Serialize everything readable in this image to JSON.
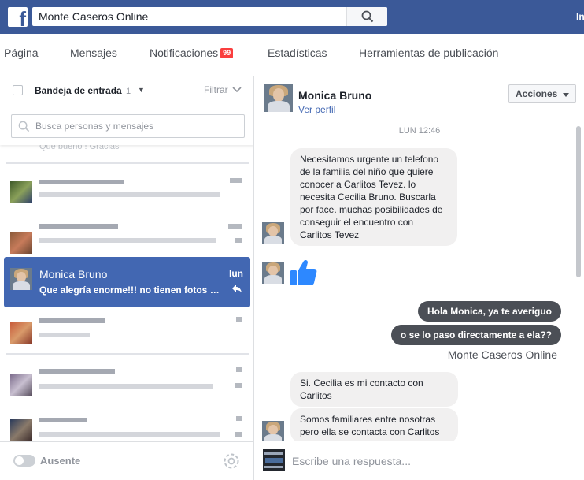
{
  "topbar": {
    "search_value": "Monte Caseros Online",
    "user_short": "In",
    "logo_letter": "f"
  },
  "page_nav": {
    "tabs": [
      "Página",
      "Mensajes",
      "Notificaciones",
      "Estadísticas",
      "Herramientas de publicación"
    ],
    "notifications_badge": "99"
  },
  "inbox": {
    "title": "Bandeja de entrada",
    "count": "1",
    "filter_label": "Filtrar",
    "search_placeholder": "Busca personas y mensajes",
    "clipped_preview": "Que bueno ! Gracias",
    "active_thread": {
      "name": "Monica Bruno",
      "snippet": "Que alegría enorme!!! no tienen fotos pa...",
      "time": "lun"
    },
    "footer_status": "Ausente"
  },
  "conversation": {
    "name": "Monica Bruno",
    "profile_link": "Ver perfil",
    "actions_label": "Acciones",
    "time_separator": "LUN 12:46",
    "messages": [
      {
        "from": "them",
        "text": "Necesitamos urgente un telefono de la familia del niño que quiere conocer a Carlitos Tevez. lo necesita Cecilia Bruno. Buscarla por face. muchas posibilidades de conseguir el encuentro con Carlitos Tevez"
      },
      {
        "from": "me",
        "text": "Hola Monica, ya te averiguo"
      },
      {
        "from": "me",
        "text": "o se lo paso directamente a ela??"
      },
      {
        "from": "them",
        "text": "Si. Cecilia es mi contacto con Carlitos"
      },
      {
        "from": "them",
        "text": "Somos familiares entre nosotras pero ella se contacta con Carlitos"
      }
    ],
    "sender_label": "Monte Caseros Online",
    "composer_placeholder": "Escribe una respuesta..."
  },
  "colors": {
    "brand": "#3b5998",
    "active_thread": "#4267b2",
    "outgoing_bubble": "#4b4f56",
    "incoming_bubble": "#f1f0f0",
    "badge": "#fa3e3e",
    "thumbs": "#2d88ff"
  }
}
